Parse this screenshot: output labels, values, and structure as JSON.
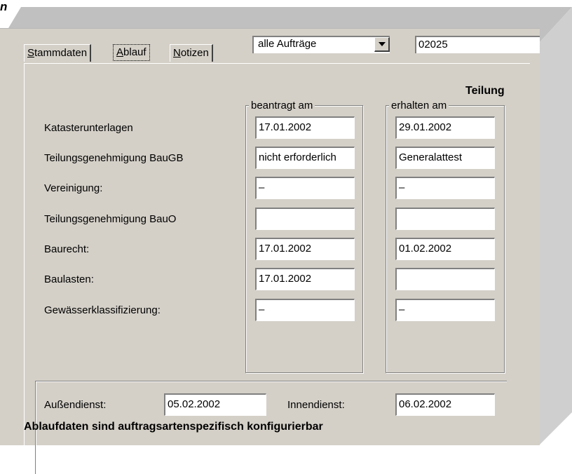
{
  "corner_glyph": "n",
  "tabs": [
    {
      "label": "Stammdaten",
      "active": false
    },
    {
      "label": "Ablauf",
      "active": true
    },
    {
      "label": "Notizen",
      "active": false
    }
  ],
  "filter": {
    "selected": "alle Aufträge"
  },
  "order_number": "02025",
  "section_title": "Teilung",
  "groups": {
    "requested": "beantragt am",
    "received": "erhalten am"
  },
  "rows": [
    {
      "label": "Katasterunterlagen",
      "requested": "17.01.2002",
      "received": "29.01.2002"
    },
    {
      "label": "Teilungsgenehmigung BauGB",
      "requested": "nicht erforderlich",
      "received": "Generalattest"
    },
    {
      "label": "Vereinigung:",
      "requested": "–",
      "received": "–"
    },
    {
      "label": "Teilungsgenehmigung BauO",
      "requested": "",
      "received": ""
    },
    {
      "label": "Baurecht:",
      "requested": "17.01.2002",
      "received": "01.02.2002"
    },
    {
      "label": "Baulasten:",
      "requested": "17.01.2002",
      "received": ""
    },
    {
      "label": "Gewässerklassifizierung:",
      "requested": "–",
      "received": "–"
    }
  ],
  "service": {
    "field_label": "Außendienst:",
    "field_value": "05.02.2002",
    "office_label": "Innendienst:",
    "office_value": "06.02.2002"
  },
  "caption": "Ablaufdaten sind auftragsartenspezifisch konfigurierbar"
}
